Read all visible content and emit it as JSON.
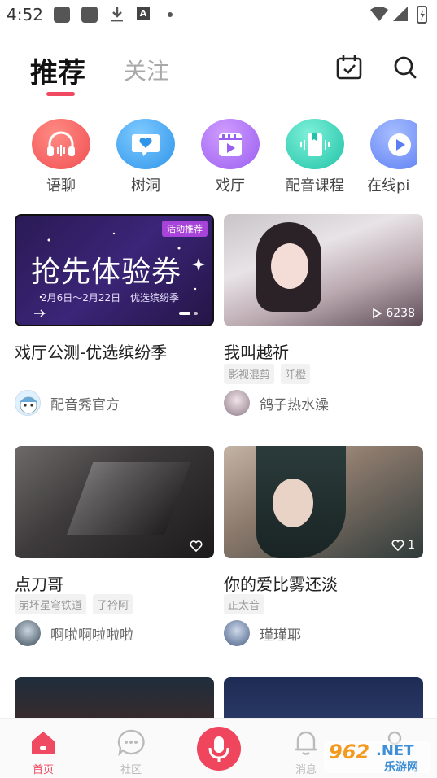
{
  "status_bar": {
    "time": "4:52"
  },
  "header": {
    "tabs": [
      {
        "label": "推荐",
        "active": true
      },
      {
        "label": "关注",
        "active": false
      }
    ],
    "accent_color": "#f04a63"
  },
  "categories": [
    {
      "label": "语聊",
      "icon": "headphones-icon",
      "color": "#f25a5f"
    },
    {
      "label": "树洞",
      "icon": "heart-chat-icon",
      "color": "#3fa3ee"
    },
    {
      "label": "戏厅",
      "icon": "film-icon",
      "color": "#a46cf0"
    },
    {
      "label": "配音课程",
      "icon": "book-icon",
      "color": "#2fcdb5"
    },
    {
      "label": "在线pi",
      "icon": "play-icon",
      "color": "#6f8ef6"
    }
  ],
  "feed": [
    {
      "title": "戏厅公测-优选缤纷季",
      "badge": "活动推荐",
      "banner_title": "抢先体验券",
      "banner_date": "2月6日～2月22日",
      "banner_sub": "优选缤纷季",
      "tags": [],
      "author": "配音秀官方",
      "stat": ""
    },
    {
      "title": "我叫越祈",
      "badge": "",
      "tags": [
        "影视混剪",
        "阡橙"
      ],
      "author": "鸽子热水澡",
      "stat": "6238"
    },
    {
      "title": "点刀哥",
      "badge": "",
      "tags": [
        "崩坏星穹铁道",
        "子衿阿"
      ],
      "author": "啊啦啊啦啦啦",
      "stat": ""
    },
    {
      "title": "你的爱比雾还淡",
      "badge": "",
      "tags": [
        "正太音"
      ],
      "author": "瑾瑾耶",
      "stat": "1"
    }
  ],
  "bottom_nav": [
    {
      "label": "首页",
      "icon": "home-icon",
      "active": true
    },
    {
      "label": "社区",
      "icon": "chat-bubble-icon",
      "active": false
    },
    {
      "label": "",
      "icon": "microphone-icon",
      "active": false
    },
    {
      "label": "消息",
      "icon": "bell-icon",
      "active": false
    },
    {
      "label": "",
      "icon": "user-icon",
      "active": false
    }
  ],
  "watermark": {
    "brand": "962",
    "suffix": ".NET",
    "sub": "乐游网"
  }
}
